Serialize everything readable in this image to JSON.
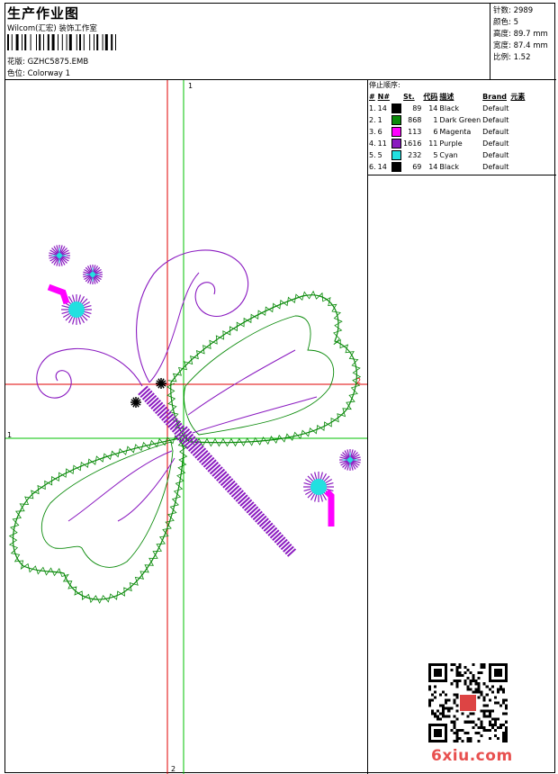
{
  "header": {
    "title": "生产作业图",
    "subtitle": "Wilcom(汇宏) 装饰工作室",
    "design_label": "花版: GZHC5875.EMB",
    "colorway_label": "色位: Colorway 1"
  },
  "stats": {
    "stitches": "针数: 2989",
    "colors": "颜色: 5",
    "height": "高度: 89.7 mm",
    "width": "宽度: 87.4 mm",
    "scale": "比例: 1.52"
  },
  "sequence": {
    "title": "停止顺序:",
    "headers": [
      "#",
      "N#",
      "St.",
      "代码",
      "描述",
      "Brand",
      "元素"
    ],
    "rows": [
      {
        "idx": "1.",
        "n": "14",
        "color": "#000000",
        "st": "89",
        "code": "14",
        "desc": "Black",
        "brand": "Default"
      },
      {
        "idx": "2.",
        "n": "1",
        "color": "#0a8a0a",
        "st": "868",
        "code": "1",
        "desc": "Dark Green",
        "brand": "Default"
      },
      {
        "idx": "3.",
        "n": "6",
        "color": "#ff00ff",
        "st": "113",
        "code": "6",
        "desc": "Magenta",
        "brand": "Default"
      },
      {
        "idx": "4.",
        "n": "11",
        "color": "#8a1ac0",
        "st": "1616",
        "code": "11",
        "desc": "Purple",
        "brand": "Default"
      },
      {
        "idx": "5.",
        "n": "5",
        "color": "#22e0e0",
        "st": "232",
        "code": "5",
        "desc": "Cyan",
        "brand": "Default"
      },
      {
        "idx": "6.",
        "n": "14",
        "color": "#000000",
        "st": "69",
        "code": "14",
        "desc": "Black",
        "brand": "Default"
      }
    ]
  },
  "axes": {
    "green_v_label": "1",
    "green_h_label": "1",
    "red_h_label": "2",
    "red_v_label": "2"
  },
  "watermark": {
    "text": "6xiu.com"
  },
  "colors": {
    "green": "#0a8a0a",
    "purple": "#8a1ac0",
    "magenta": "#ff00ff",
    "cyan": "#22e0e0",
    "red_axis": "#e00000",
    "green_axis": "#00c000"
  }
}
